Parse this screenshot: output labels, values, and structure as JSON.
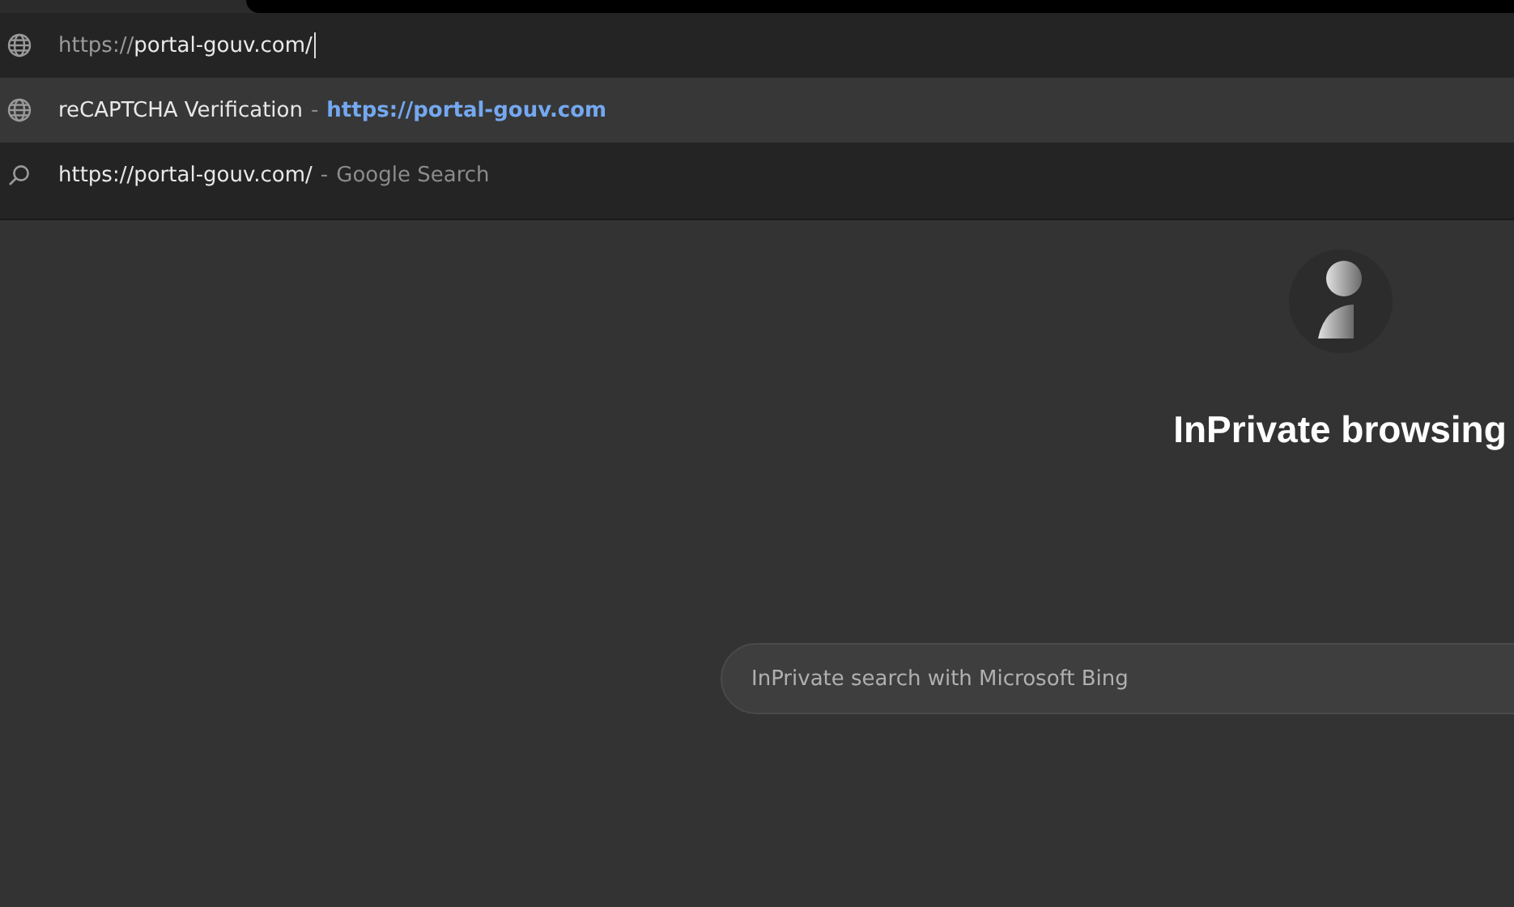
{
  "address_bar": {
    "scheme": "https://",
    "host": "portal-gouv.com/"
  },
  "suggestions": [
    {
      "kind": "page",
      "selected": true,
      "title": "reCAPTCHA Verification",
      "separator": "-",
      "url": "https://portal-gouv.com"
    },
    {
      "kind": "search",
      "selected": false,
      "title": "https://portal-gouv.com/",
      "separator": "-",
      "url": "Google Search"
    }
  ],
  "new_tab": {
    "heading": "InPrivate browsing",
    "search": {
      "placeholder": "InPrivate search with Microsoft Bing"
    }
  }
}
